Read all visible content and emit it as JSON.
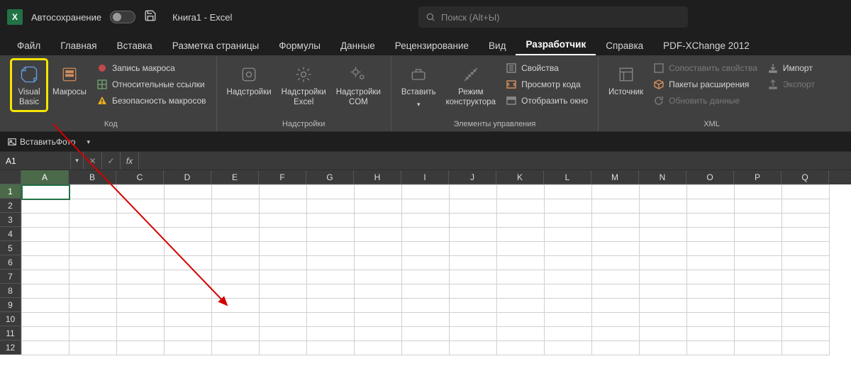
{
  "title_bar": {
    "autosave_label": "Автосохранение",
    "document_title": "Книга1  -  Excel",
    "search_placeholder": "Поиск (Alt+Ы)"
  },
  "tabs": [
    {
      "label": "Файл",
      "active": false
    },
    {
      "label": "Главная",
      "active": false
    },
    {
      "label": "Вставка",
      "active": false
    },
    {
      "label": "Разметка страницы",
      "active": false
    },
    {
      "label": "Формулы",
      "active": false
    },
    {
      "label": "Данные",
      "active": false
    },
    {
      "label": "Рецензирование",
      "active": false
    },
    {
      "label": "Вид",
      "active": false
    },
    {
      "label": "Разработчик",
      "active": true
    },
    {
      "label": "Справка",
      "active": false
    },
    {
      "label": "PDF-XChange 2012",
      "active": false
    }
  ],
  "ribbon": {
    "code_group": {
      "label": "Код",
      "visual_basic": "Visual\nBasic",
      "macros": "Макросы",
      "record_macro": "Запись макроса",
      "relative_refs": "Относительные ссылки",
      "macro_security": "Безопасность макросов"
    },
    "addins_group": {
      "label": "Надстройки",
      "addins": "Надстройки",
      "excel_addins": "Надстройки\nExcel",
      "com_addins": "Надстройки\nCOM"
    },
    "controls_group": {
      "label": "Элементы управления",
      "insert": "Вставить",
      "design_mode": "Режим\nконструктора",
      "properties": "Свойства",
      "view_code": "Просмотр кода",
      "run_dialog": "Отобразить окно"
    },
    "xml_group": {
      "label": "XML",
      "source": "Источник",
      "map_properties": "Сопоставить свойства",
      "expansion_packs": "Пакеты расширения",
      "refresh_data": "Обновить данные",
      "import": "Импорт",
      "export": "Экспорт"
    }
  },
  "qat2": {
    "insert_photo": "ВставитьФото"
  },
  "formula_bar": {
    "name_box": "A1",
    "fx": "fx"
  },
  "grid": {
    "columns": [
      "A",
      "B",
      "C",
      "D",
      "E",
      "F",
      "G",
      "H",
      "I",
      "J",
      "K",
      "L",
      "M",
      "N",
      "O",
      "P",
      "Q"
    ],
    "rows": [
      "1",
      "2",
      "3",
      "4",
      "5",
      "6",
      "7",
      "8",
      "9",
      "10",
      "11",
      "12"
    ],
    "active_cell": "A1"
  }
}
